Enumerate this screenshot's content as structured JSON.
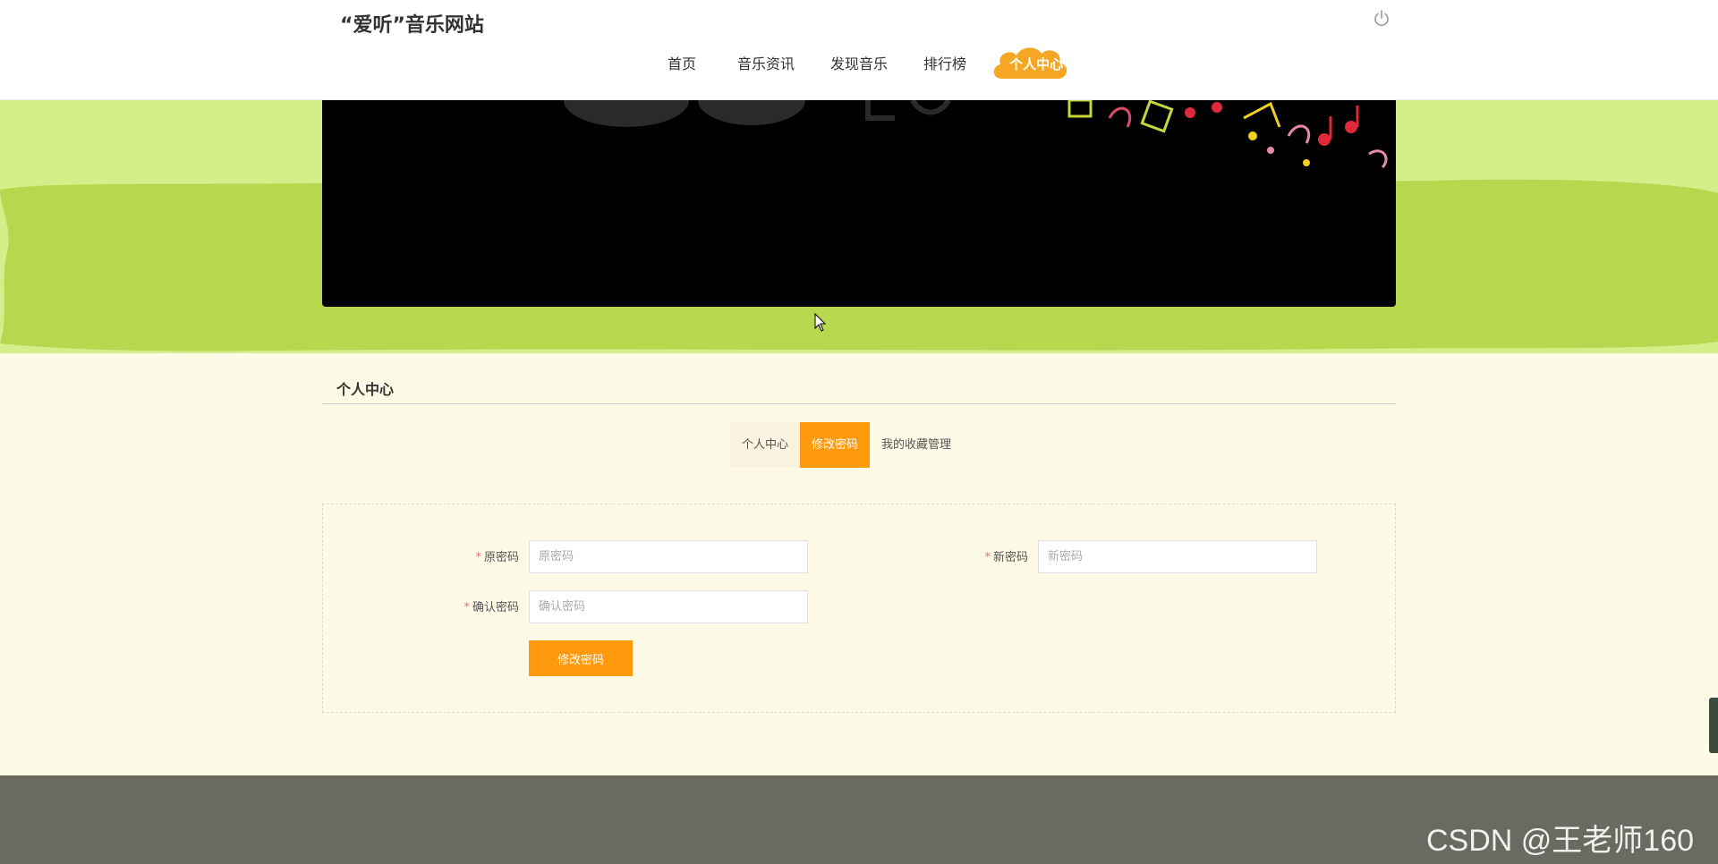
{
  "header": {
    "site_title": "“爱听”音乐网站",
    "nav": [
      {
        "label": "首页"
      },
      {
        "label": "音乐资讯"
      },
      {
        "label": "发现音乐"
      },
      {
        "label": "排行榜"
      },
      {
        "label": "个人中心",
        "active": true
      }
    ],
    "power_icon": "power-icon"
  },
  "section": {
    "title": "个人中心"
  },
  "tabs": [
    {
      "label": "个人中心"
    },
    {
      "label": "修改密码",
      "active": true
    },
    {
      "label": "我的收藏管理"
    }
  ],
  "form": {
    "old_password": {
      "label": "原密码",
      "placeholder": "原密码",
      "value": ""
    },
    "new_password": {
      "label": "新密码",
      "placeholder": "新密码",
      "value": ""
    },
    "confirm_password": {
      "label": "确认密码",
      "placeholder": "确认密码",
      "value": ""
    },
    "required_mark": "*",
    "submit_label": "修改密码"
  },
  "watermark": "CSDN @王老师160",
  "colors": {
    "accent": "#ff9a0e",
    "banner_light": "#d5ee8a",
    "banner_dark": "#b5d84e",
    "page_bg": "#fdfbe6",
    "footer": "#6a6a60"
  }
}
